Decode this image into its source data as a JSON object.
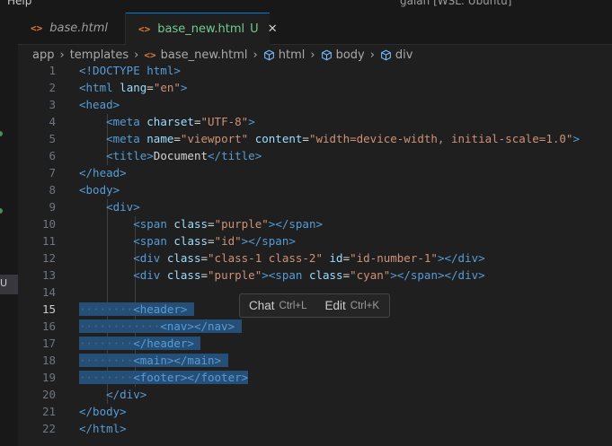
{
  "window": {
    "menu_partial": "Help",
    "title_partial": "galah [WSL: Ubuntu]"
  },
  "activity_bar": {
    "indicator": "U"
  },
  "tabs": [
    {
      "label": "base.html",
      "icon": "html-file-icon",
      "active": false
    },
    {
      "label": "base_new.html",
      "status": "U",
      "icon": "html-file-icon",
      "active": true,
      "close": "✕"
    }
  ],
  "breadcrumb": {
    "items": [
      "app",
      "templates",
      "base_new.html",
      "html",
      "body",
      "div"
    ]
  },
  "editor": {
    "active_line": 15,
    "lines": [
      {
        "n": "1"
      },
      {
        "n": "2"
      },
      {
        "n": "3"
      },
      {
        "n": "4"
      },
      {
        "n": "5"
      },
      {
        "n": "6"
      },
      {
        "n": "7"
      },
      {
        "n": "8"
      },
      {
        "n": "9"
      },
      {
        "n": "10"
      },
      {
        "n": "11"
      },
      {
        "n": "12"
      },
      {
        "n": "13"
      },
      {
        "n": "14"
      },
      {
        "n": "15"
      },
      {
        "n": "16"
      },
      {
        "n": "17"
      },
      {
        "n": "18"
      },
      {
        "n": "19"
      },
      {
        "n": "20"
      },
      {
        "n": "21"
      },
      {
        "n": "22"
      }
    ],
    "tokens": {
      "doctype": "<!DOCTYPE html>",
      "html_open": "<html",
      "lang_attr": "lang",
      "lang_val": "\"en\"",
      "head_open": "<head>",
      "meta": "<meta",
      "charset_attr": "charset",
      "charset_val": "\"UTF-8\"",
      "name_attr": "name",
      "name_val": "\"viewport\"",
      "content_attr": "content",
      "content_val": "\"width=device-width, initial-scale=1.0\"",
      "title_open": "<title>",
      "title_text": "Document",
      "title_close": "</title>",
      "head_close": "</head>",
      "body_open": "<body>",
      "div_open": "<div>",
      "span": "<span",
      "span_close": "</span>",
      "div": "<div",
      "div_close": "</div>",
      "class_attr": "class",
      "id_attr": "id",
      "purple_val": "\"purple\"",
      "id_val": "\"id\"",
      "class12_val": "\"class-1 class-2\"",
      "idnum_val": "\"id-number-1\"",
      "cyan_val": "\"cyan\"",
      "header_open": "<header>",
      "header_close": "</header>",
      "nav_pair": "<nav></nav>",
      "main_pair": "<main></main>",
      "footer_pair": "<footer></footer>",
      "body_close": "</body>",
      "html_close": "</html>"
    }
  },
  "inline_hint": {
    "chat_label": "Chat",
    "chat_key": "Ctrl+L",
    "edit_label": "Edit",
    "edit_key": "Ctrl+K"
  },
  "colors": {
    "background": "#1f1f1f",
    "tag": "#569cd6",
    "attribute": "#9cdcfe",
    "string": "#ce9178",
    "selection": "#264f78",
    "untracked": "#73c991",
    "html_icon": "#e37933"
  }
}
